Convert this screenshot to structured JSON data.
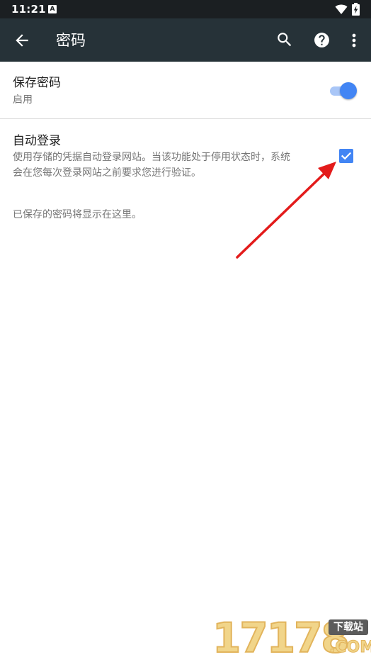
{
  "status_bar": {
    "time": "11:21",
    "notification_letter": "A"
  },
  "toolbar": {
    "title": "密码",
    "icons": [
      "back-arrow-icon",
      "search-icon",
      "help-icon",
      "more-vert-icon"
    ]
  },
  "save_passwords": {
    "title": "保存密码",
    "status": "启用",
    "enabled": true
  },
  "auto_sign_in": {
    "title": "自动登录",
    "description_line1": "使用存储的凭据自动登录网站。当该功能处于停用状态时，系统",
    "description_line2": "会在您每次登录网站之前要求您进行验证。",
    "checked": true
  },
  "empty_message": "已保存的密码将显示在这里。",
  "watermark": {
    "number": "17178",
    "badge": "下载站",
    "domain": ".COM"
  },
  "colors": {
    "toolbar": "#263238",
    "status_bar": "#1b1f22",
    "accent": "#4285f4",
    "arrow": "#e31b1b"
  }
}
